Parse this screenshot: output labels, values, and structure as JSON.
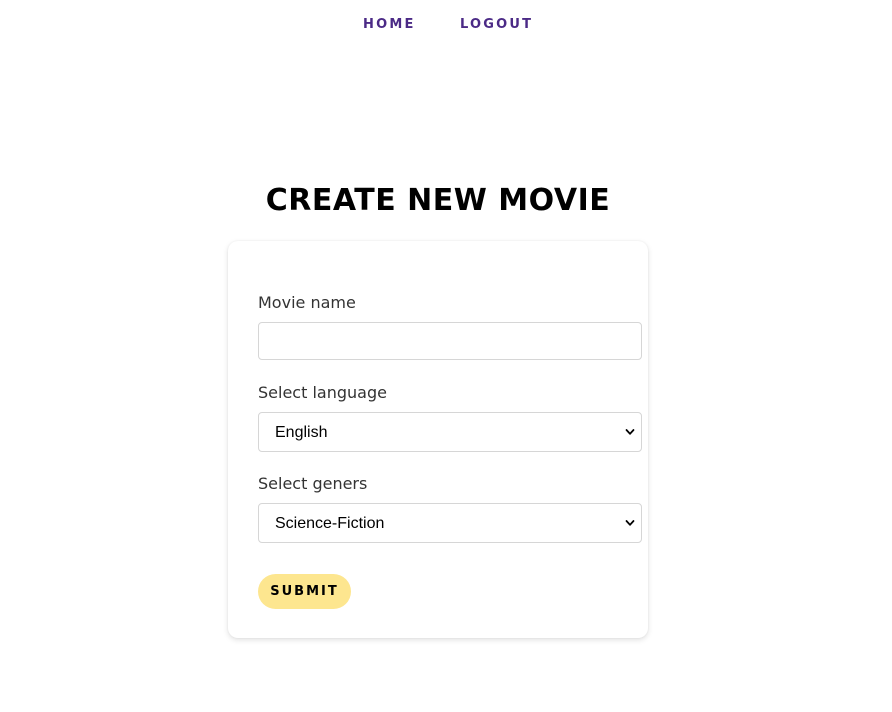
{
  "nav": {
    "home_label": "HOME",
    "logout_label": "LOGOUT",
    "link_color": "#4b2a86"
  },
  "page": {
    "title": "CREATE NEW MOVIE"
  },
  "form": {
    "movie_name": {
      "label": "Movie name",
      "value": "",
      "placeholder": ""
    },
    "language": {
      "label": "Select language",
      "selected": "English"
    },
    "genre": {
      "label": "Select geners",
      "selected": "Science-Fiction"
    },
    "submit_label": "SUBMIT",
    "submit_color": "#fde68f"
  },
  "icons": {
    "dropdown": "chevron-down-icon"
  }
}
